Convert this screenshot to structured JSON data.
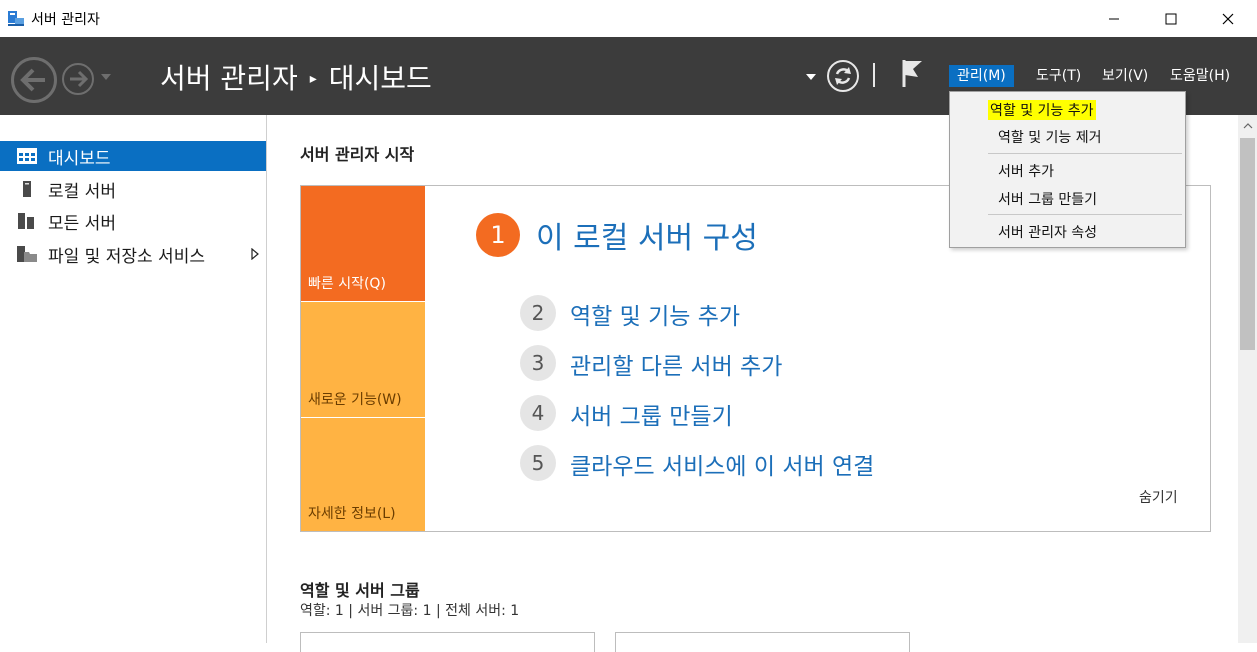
{
  "window": {
    "title": "서버 관리자",
    "controls": [
      "minimize",
      "maximize",
      "close"
    ]
  },
  "header": {
    "breadcrumb_root": "서버 관리자",
    "breadcrumb_separator": "▸",
    "breadcrumb_current": "대시보드",
    "menus": {
      "manage": "관리(M)",
      "tools": "도구(T)",
      "view": "보기(V)",
      "help": "도움말(H)"
    }
  },
  "manage_menu": {
    "items": [
      {
        "label": "역할 및 기능 추가",
        "highlighted": true
      },
      {
        "label": "역할 및 기능 제거"
      },
      {
        "label": "서버 추가"
      },
      {
        "label": "서버 그룹 만들기"
      },
      {
        "label": "서버 관리자 속성"
      }
    ]
  },
  "sidebar": {
    "items": [
      {
        "label": "대시보드",
        "icon": "dashboard-icon",
        "selected": true
      },
      {
        "label": "로컬 서버",
        "icon": "local-server-icon"
      },
      {
        "label": "모든 서버",
        "icon": "all-servers-icon"
      },
      {
        "label": "파일 및 저장소 서비스",
        "icon": "file-storage-icon",
        "has_submenu": true
      }
    ]
  },
  "main": {
    "welcome_title": "서버 관리자 시작",
    "tiles": {
      "quick_start": "빠른 시작(Q)",
      "whats_new": "새로운 기능(W)",
      "learn_more": "자세한 정보(L)"
    },
    "steps": [
      {
        "num": "1",
        "label": "이 로컬 서버 구성"
      },
      {
        "num": "2",
        "label": "역할 및 기능 추가"
      },
      {
        "num": "3",
        "label": "관리할 다른 서버 추가"
      },
      {
        "num": "4",
        "label": "서버 그룹 만들기"
      },
      {
        "num": "5",
        "label": "클라우드 서비스에 이 서버 연결"
      }
    ],
    "hide_link": "숨기기",
    "roles_title": "역할 및 서버 그룹",
    "roles_summary": "역할: 1   |   서버 그룹: 1   |   전체 서버: 1"
  },
  "colors": {
    "header_bg": "#3c3c3c",
    "accent_blue": "#0a6fc2",
    "tile_orange": "#f36b21",
    "tile_light_orange": "#ffb343",
    "link_blue": "#1c6fb9",
    "highlight_yellow": "#ffff00"
  }
}
